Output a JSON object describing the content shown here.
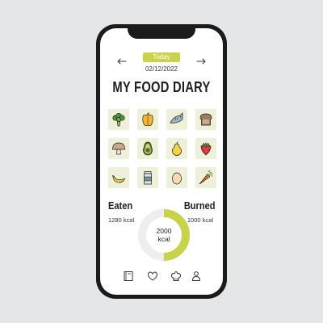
{
  "header": {
    "today_label": "Today",
    "date": "02/12/2022",
    "title": "MY FOOD DIARY",
    "prev_icon": "arrow-left-icon",
    "next_icon": "arrow-right-icon"
  },
  "foods": [
    {
      "icon": "broccoli-icon"
    },
    {
      "icon": "bell-pepper-icon"
    },
    {
      "icon": "fish-icon"
    },
    {
      "icon": "bread-icon"
    },
    {
      "icon": "mushroom-icon"
    },
    {
      "icon": "avocado-icon"
    },
    {
      "icon": "pear-icon"
    },
    {
      "icon": "strawberry-icon"
    },
    {
      "icon": "banana-icon"
    },
    {
      "icon": "milk-carton-icon"
    },
    {
      "icon": "egg-icon"
    },
    {
      "icon": "carrot-icon"
    }
  ],
  "stats": {
    "eaten_label": "Eaten",
    "eaten_value": "1280 kcal",
    "burned_label": "Burned",
    "burned_value": "1000 kcal",
    "total_value": "2000",
    "total_unit": "kcal",
    "eaten_fraction": 0.5
  },
  "tabbar": [
    {
      "icon": "diary-icon"
    },
    {
      "icon": "heart-icon"
    },
    {
      "icon": "chef-hat-icon"
    },
    {
      "icon": "profile-icon"
    }
  ],
  "colors": {
    "accent": "#c8d34a",
    "tile_bg": "#eef0d9",
    "donut_track": "#eeeeee",
    "phone_frame": "#1b1b1b",
    "background": "#e5e6e8"
  }
}
